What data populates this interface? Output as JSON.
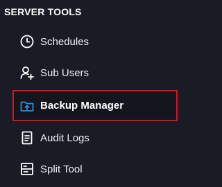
{
  "sidebar": {
    "section_title": "SERVER TOOLS",
    "items": [
      {
        "label": "Schedules",
        "icon": "clock-icon",
        "active": false
      },
      {
        "label": "Sub Users",
        "icon": "user-add-icon",
        "active": false
      },
      {
        "label": "Backup Manager",
        "icon": "folder-upload-icon",
        "active": true
      },
      {
        "label": "Audit Logs",
        "icon": "document-icon",
        "active": false
      },
      {
        "label": "Split Tool",
        "icon": "split-icon",
        "active": false
      }
    ]
  },
  "colors": {
    "background": "#1a1b24",
    "text": "#ffffff",
    "highlight_border": "#e0101c",
    "active_icon": "#2e8fe0"
  }
}
